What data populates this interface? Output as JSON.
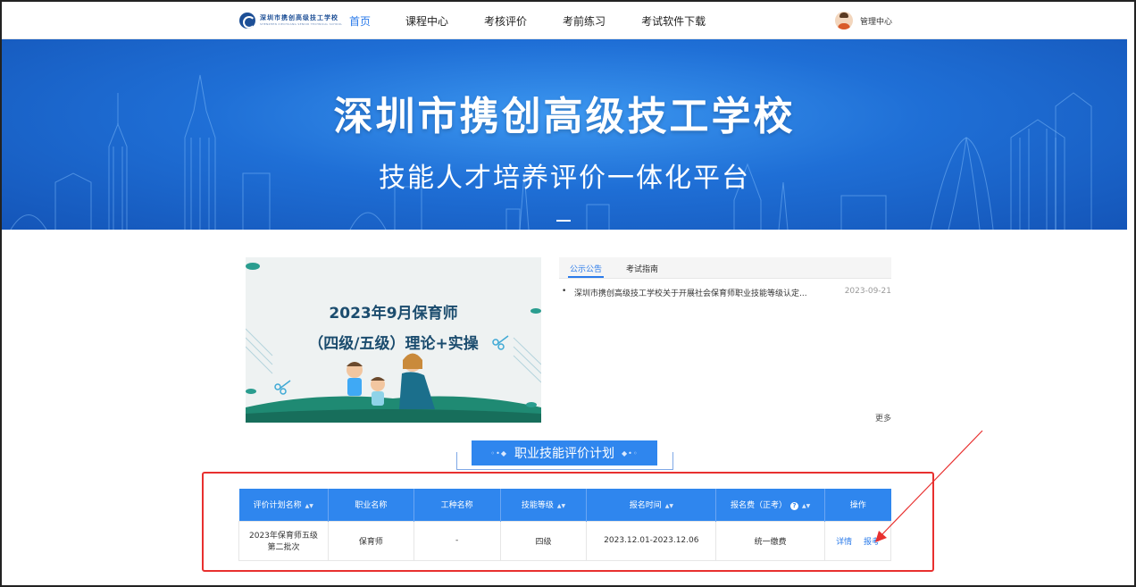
{
  "header": {
    "logo_cn": "深圳市携创高级技工学校",
    "logo_en": "SHENZHEN XIECHUANG SENIOR TECHNICAL SCHOOL",
    "nav": [
      "首页",
      "课程中心",
      "考核评价",
      "考前练习",
      "考试软件下载"
    ],
    "user_label": "管理中心"
  },
  "banner": {
    "title": "深圳市携创高级技工学校",
    "subtitle": "技能人才培养评价一体化平台"
  },
  "feature": {
    "line1": "2023年9月保育师",
    "line2": "（四级/五级）理论+实操"
  },
  "notice": {
    "tabs": [
      "公示公告",
      "考试指南"
    ],
    "items": [
      {
        "text": "深圳市携创高级技工学校关于开展社会保育师职业技能等级认定...",
        "date": "2023-09-21"
      }
    ],
    "more": "更多"
  },
  "section": {
    "title": "职业技能评价计划"
  },
  "table": {
    "headers": [
      "评价计划名称",
      "职业名称",
      "工种名称",
      "技能等级",
      "报名时间",
      "报名费（正考）",
      "操作"
    ],
    "rows": [
      {
        "plan_line1": "2023年保育师五级",
        "plan_line2": "第二批次",
        "occupation": "保育师",
        "job_type": "-",
        "level": "四级",
        "period": "2023.12.01-2023.12.06",
        "fee": "统一缴费",
        "op_detail": "详情",
        "op_apply": "报考"
      }
    ]
  },
  "colors": {
    "accent": "#2f86ee",
    "highlight_box": "#e8302f",
    "banner_blue": "#1f6fd6"
  }
}
